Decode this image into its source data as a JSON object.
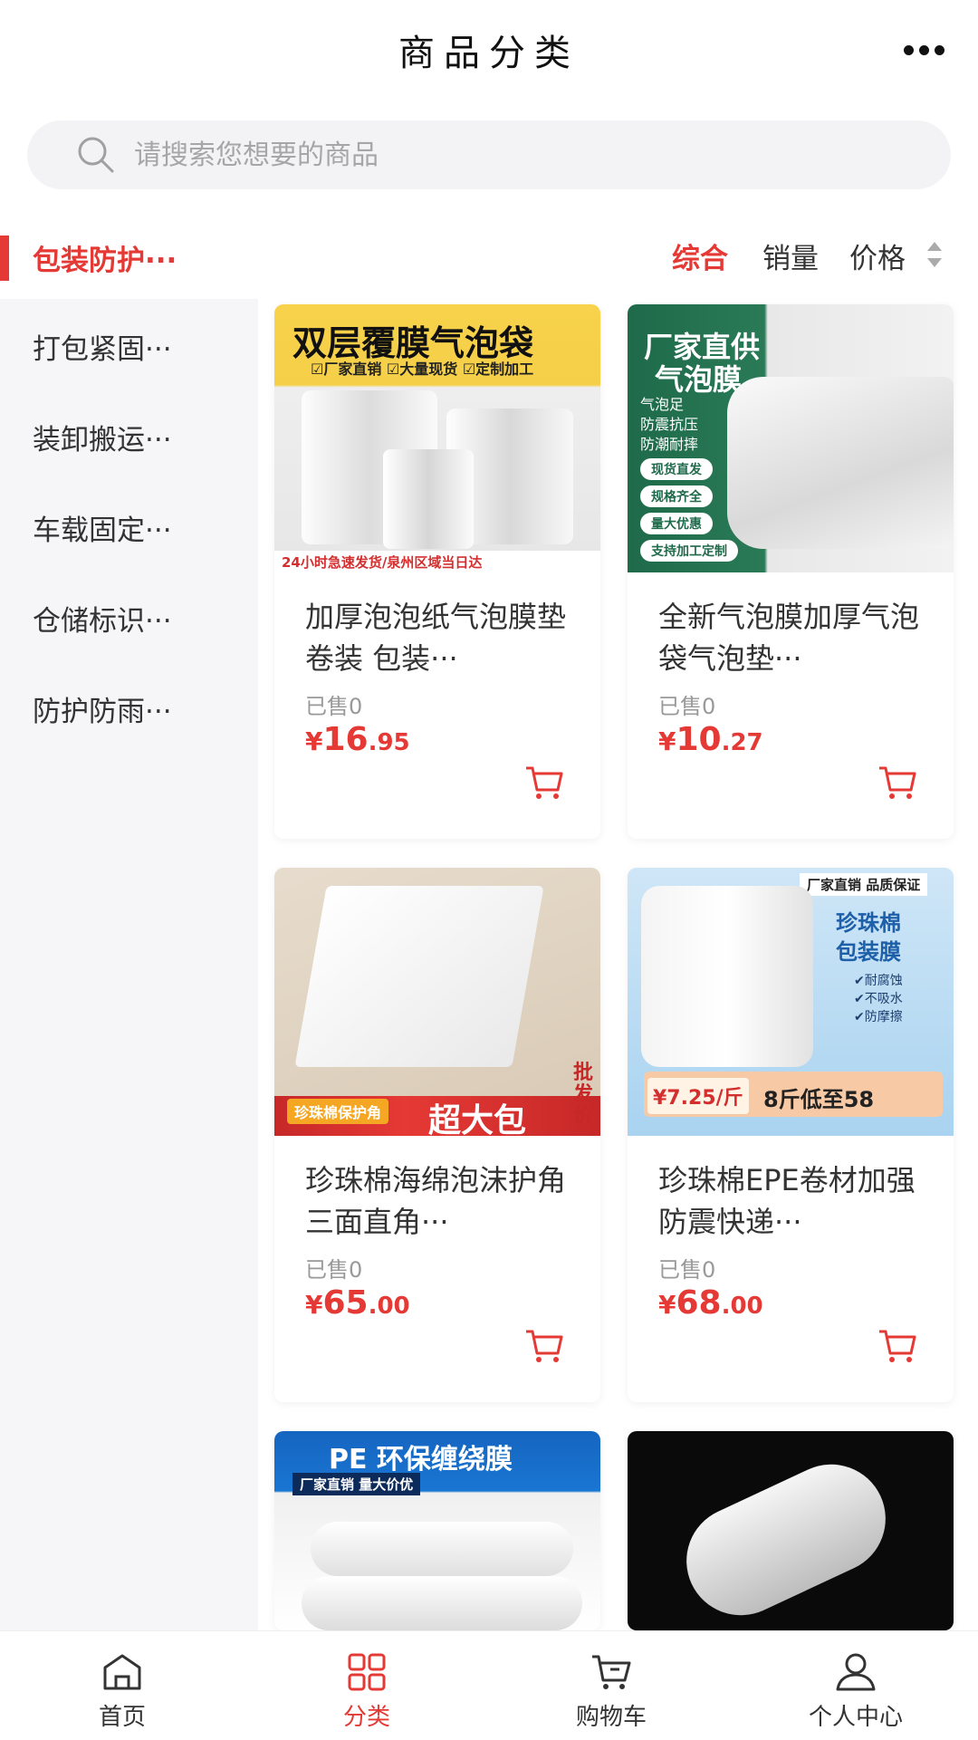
{
  "header": {
    "title": "商品分类"
  },
  "search": {
    "placeholder": "请搜索您想要的商品"
  },
  "sidebar": {
    "items": [
      {
        "label": "包装防护···",
        "active": true
      },
      {
        "label": "打包紧固···"
      },
      {
        "label": "装卸搬运···"
      },
      {
        "label": "车载固定···"
      },
      {
        "label": "仓储标识···"
      },
      {
        "label": "防护防雨···"
      }
    ]
  },
  "sort": {
    "comprehensive": "综合",
    "sales": "销量",
    "price": "价格"
  },
  "products": [
    {
      "name": "加厚泡泡纸气泡膜垫卷装 包装···",
      "sold": "已售0",
      "price_yen": "¥",
      "price_int": "16",
      "price_dec": ".95",
      "image_text": {
        "headline": "双层覆膜气泡袋",
        "tags": "☑厂家直销 ☑大量现货 ☑定制加工",
        "footer": "24小时急速发货/泉州区域当日达"
      }
    },
    {
      "name": "全新气泡膜加厚气泡袋气泡垫···",
      "sold": "已售0",
      "price_yen": "¥",
      "price_int": "10",
      "price_dec": ".27",
      "image_text": {
        "headline1": "厂家直供",
        "headline2": "气泡膜",
        "sub": "气泡足\n防震抗压\n防潮耐摔",
        "pills": [
          "现货直发",
          "规格齐全",
          "量大优惠",
          "支持加工定制"
        ]
      }
    },
    {
      "name": "珍珠棉海绵泡沫护角三面直角···",
      "sold": "已售0",
      "price_yen": "¥",
      "price_int": "65",
      "price_dec": ".00",
      "image_text": {
        "badge": "珍珠棉保护角",
        "big": "超大包",
        "side": "批发价"
      }
    },
    {
      "name": "珍珠棉EPE卷材加强防震快递···",
      "sold": "已售0",
      "price_yen": "¥",
      "price_int": "68",
      "price_dec": ".00",
      "image_text": {
        "top": "厂家直销 品质保证",
        "title": "珍珠棉\n包装膜",
        "features": "✔耐腐蚀\n✔不吸水\n✔防摩擦",
        "price_tag": "¥7.25/斤",
        "promo": "8斤低至58"
      }
    },
    {
      "image_text": {
        "headline": "PE 环保缠绕膜",
        "tags": "厂家直销  量大价优"
      }
    },
    {
      "image_text": {}
    }
  ],
  "tabbar": {
    "items": [
      {
        "label": "首页",
        "icon": "home-icon"
      },
      {
        "label": "分类",
        "icon": "category-icon",
        "active": true
      },
      {
        "label": "购物车",
        "icon": "cart-icon"
      },
      {
        "label": "个人中心",
        "icon": "user-icon"
      }
    ]
  },
  "colors": {
    "accent": "#e53935",
    "sidebar_bg": "#f6f6f8",
    "search_bg": "#f3f3f5"
  }
}
